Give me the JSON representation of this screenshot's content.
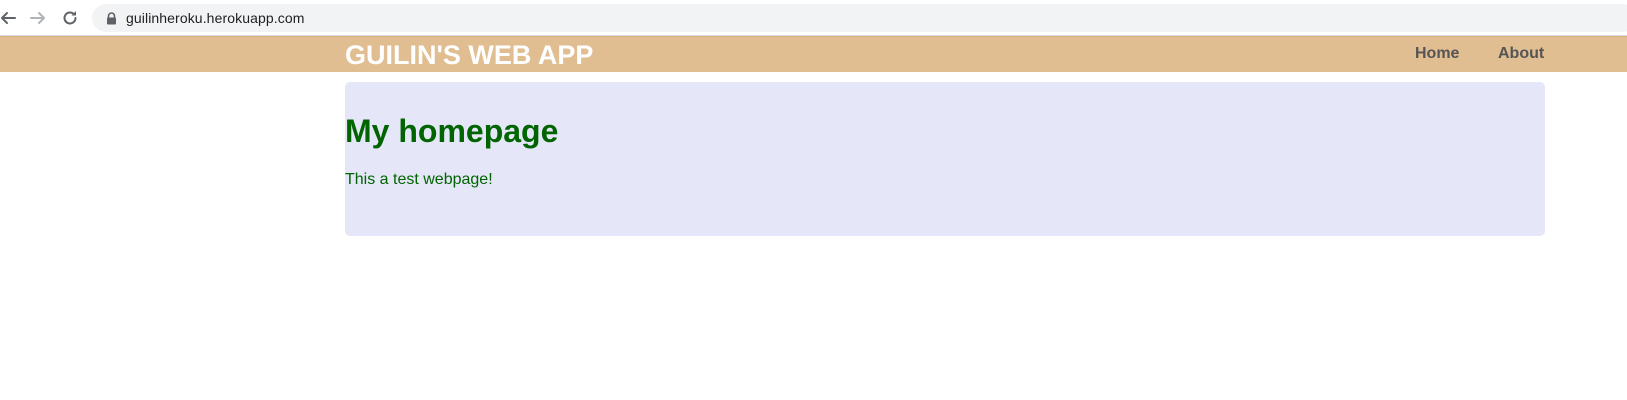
{
  "browser": {
    "url": "guilinheroku.herokuapp.com",
    "icons": {
      "back": "arrow-left-icon",
      "forward": "arrow-right-icon",
      "reload": "reload-icon",
      "lock": "lock-icon"
    }
  },
  "header": {
    "title": "GUILIN'S WEB APP",
    "nav": [
      {
        "label": "Home"
      },
      {
        "label": "About"
      }
    ]
  },
  "main": {
    "heading": "My homepage",
    "text": "This a test webpage!"
  },
  "colors": {
    "header_bg": "#e0be91",
    "card_bg": "#e5e6f8",
    "text_green": "#006400",
    "title_white": "#ffffff",
    "nav_gray": "#555555"
  }
}
